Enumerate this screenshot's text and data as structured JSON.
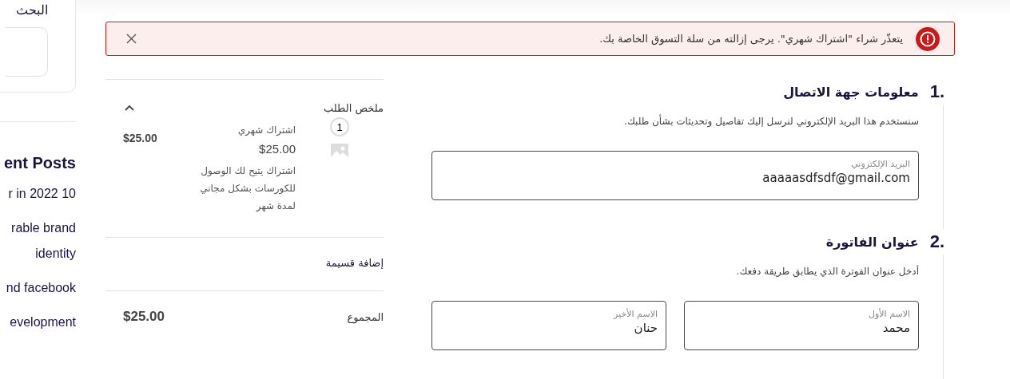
{
  "sidebar": {
    "search_label": "البحث",
    "recent_posts_heading": "ent Posts",
    "posts": [
      "r in 2022 10",
      "rable brand identity",
      "nd facebook",
      "evelopment"
    ]
  },
  "alert": {
    "kind": "error",
    "message": "يتعذّر شراء \"اشتراك شهري\". يرجى إزالته من سلة التسوق الخاصة بك."
  },
  "summary": {
    "title": "ملخص الطلب",
    "expanded": true,
    "items": [
      {
        "quantity": "1",
        "name": "اشتراك شهري",
        "unit_price": "$25.00",
        "description": "اشتراك يتيح لك الوصول للكورسات بشكل مجاني لمدة  شهر",
        "total": "$25.00"
      }
    ],
    "coupon_label": "إضافة قسيمة",
    "total_label": "المجموع",
    "total_value": "$25.00"
  },
  "sections": [
    {
      "number": "1.",
      "title": "معلومات جهة الاتصال",
      "description": "سنستخدم هذا البريد الإلكتروني لنرسل إليك تفاصيل وتحديثات بشأن طلبك.",
      "fields": [
        {
          "label": "البريد الإلكتروني",
          "value": "aaaaasdfsdf@gmail.com"
        }
      ]
    },
    {
      "number": "2.",
      "title": "عنوان الفاتورة",
      "description": "أدخل عنوان الفوترة الذي يطابق طريقة دفعك.",
      "fields": [
        {
          "label": "الاسم الأول",
          "value": "محمد"
        },
        {
          "label": "الاسم الأخير",
          "value": "حنان"
        }
      ]
    }
  ]
}
